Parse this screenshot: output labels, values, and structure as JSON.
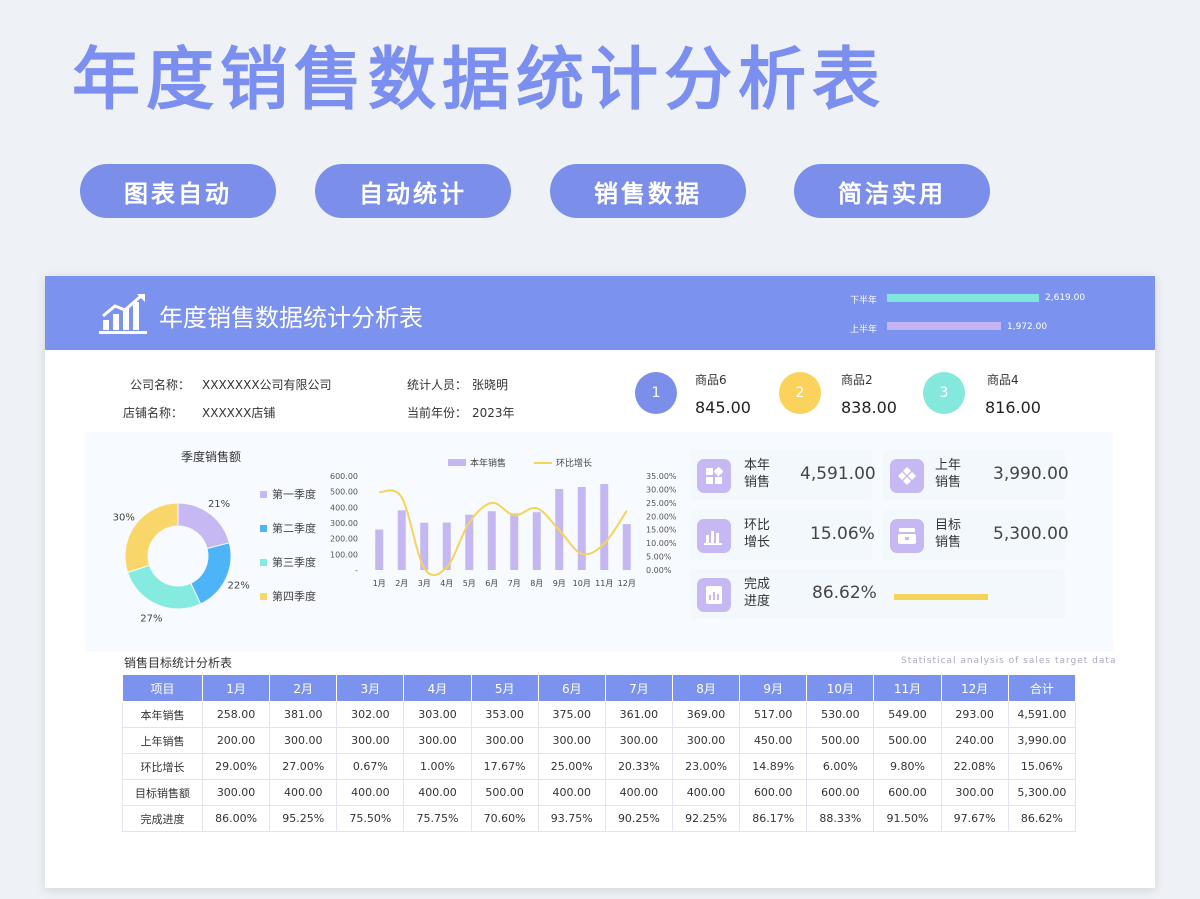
{
  "header": {
    "big_title": "年度销售数据统计分析表",
    "tags": [
      "图表自动",
      "自动统计",
      "销售数据",
      "简洁实用"
    ]
  },
  "sheet": {
    "title": "年度销售数据统计分析表",
    "half_year": [
      {
        "label": "下半年",
        "value": 2619,
        "value_text": "2,619.00"
      },
      {
        "label": "上半年",
        "value": 1972,
        "value_text": "1,972.00"
      }
    ]
  },
  "info": {
    "company_label": "公司名称：",
    "company_value": "XXXXXXX公司有限公司",
    "store_label": "店铺名称：",
    "store_value": "XXXXXX店铺",
    "staff_label": "统计人员：",
    "staff_value": "张晓明",
    "year_label": "当前年份：",
    "year_value": "2023年"
  },
  "ranking": [
    {
      "rank": "1",
      "name": "商品6",
      "value": "845.00"
    },
    {
      "rank": "2",
      "name": "商品2",
      "value": "838.00"
    },
    {
      "rank": "3",
      "name": "商品4",
      "value": "816.00"
    }
  ],
  "kpis": {
    "current_sales": {
      "label": "本年销售",
      "value": "4,591.00"
    },
    "last_sales": {
      "label": "上年销售",
      "value": "3,990.00"
    },
    "growth": {
      "label": "环比增长",
      "value": "15.06%"
    },
    "target": {
      "label": "目标销售",
      "value": "5,300.00"
    },
    "completion": {
      "label": "完成进度",
      "value": "86.62%",
      "fraction": 0.8662
    }
  },
  "colors": {
    "accent": "#7b92ee",
    "rank1": "#7b8fea",
    "rank2": "#fbd35c",
    "rank3": "#84e8dc",
    "bar": "#c5b8f2",
    "line": "#f6d35a",
    "half_bottom": "#7fe6de",
    "half_top": "#c6b5f5"
  },
  "chart_data": [
    {
      "type": "pie",
      "title": "季度销售额",
      "categories": [
        "第一季度",
        "第二季度",
        "第三季度",
        "第四季度"
      ],
      "values": [
        21,
        22,
        27,
        30
      ],
      "value_labels": [
        "21%",
        "22%",
        "27%",
        "30%"
      ],
      "colors": [
        "#c6b9f3",
        "#4db5f7",
        "#85ebe0",
        "#f9d66a"
      ]
    },
    {
      "type": "bar",
      "categories": [
        "1月",
        "2月",
        "3月",
        "4月",
        "5月",
        "6月",
        "7月",
        "8月",
        "9月",
        "10月",
        "11月",
        "12月"
      ],
      "series": [
        {
          "name": "本年销售",
          "type": "bar",
          "axis": "left",
          "values": [
            258,
            381,
            302,
            303,
            353,
            375,
            361,
            369,
            517,
            530,
            549,
            293
          ]
        },
        {
          "name": "环比增长",
          "type": "line",
          "axis": "right",
          "values": [
            29.0,
            27.0,
            0.67,
            1.0,
            17.67,
            25.0,
            20.33,
            23.0,
            14.89,
            6.0,
            9.8,
            22.08
          ]
        }
      ],
      "left_ticks": [
        "600.00",
        "500.00",
        "400.00",
        "300.00",
        "200.00",
        "100.00",
        "-"
      ],
      "right_ticks": [
        "35.00%",
        "30.00%",
        "25.00%",
        "20.00%",
        "15.00%",
        "10.00%",
        "5.00%",
        "0.00%"
      ],
      "ylim_left": [
        0,
        600
      ],
      "ylim_right": [
        0,
        35
      ],
      "legend_position": "top"
    }
  ],
  "table": {
    "title": "销售目标统计分析表",
    "subtitle": "Statistical analysis of sales target data",
    "headers": [
      "项目",
      "1月",
      "2月",
      "3月",
      "4月",
      "5月",
      "6月",
      "7月",
      "8月",
      "9月",
      "10月",
      "11月",
      "12月",
      "合计"
    ],
    "rows": [
      [
        "本年销售",
        "258.00",
        "381.00",
        "302.00",
        "303.00",
        "353.00",
        "375.00",
        "361.00",
        "369.00",
        "517.00",
        "530.00",
        "549.00",
        "293.00",
        "4,591.00"
      ],
      [
        "上年销售",
        "200.00",
        "300.00",
        "300.00",
        "300.00",
        "300.00",
        "300.00",
        "300.00",
        "300.00",
        "450.00",
        "500.00",
        "500.00",
        "240.00",
        "3,990.00"
      ],
      [
        "环比增长",
        "29.00%",
        "27.00%",
        "0.67%",
        "1.00%",
        "17.67%",
        "25.00%",
        "20.33%",
        "23.00%",
        "14.89%",
        "6.00%",
        "9.80%",
        "22.08%",
        "15.06%"
      ],
      [
        "目标销售额",
        "300.00",
        "400.00",
        "400.00",
        "400.00",
        "500.00",
        "400.00",
        "400.00",
        "400.00",
        "600.00",
        "600.00",
        "600.00",
        "300.00",
        "5,300.00"
      ],
      [
        "完成进度",
        "86.00%",
        "95.25%",
        "75.50%",
        "75.75%",
        "70.60%",
        "93.75%",
        "90.25%",
        "92.25%",
        "86.17%",
        "88.33%",
        "91.50%",
        "97.67%",
        "86.62%"
      ]
    ]
  }
}
